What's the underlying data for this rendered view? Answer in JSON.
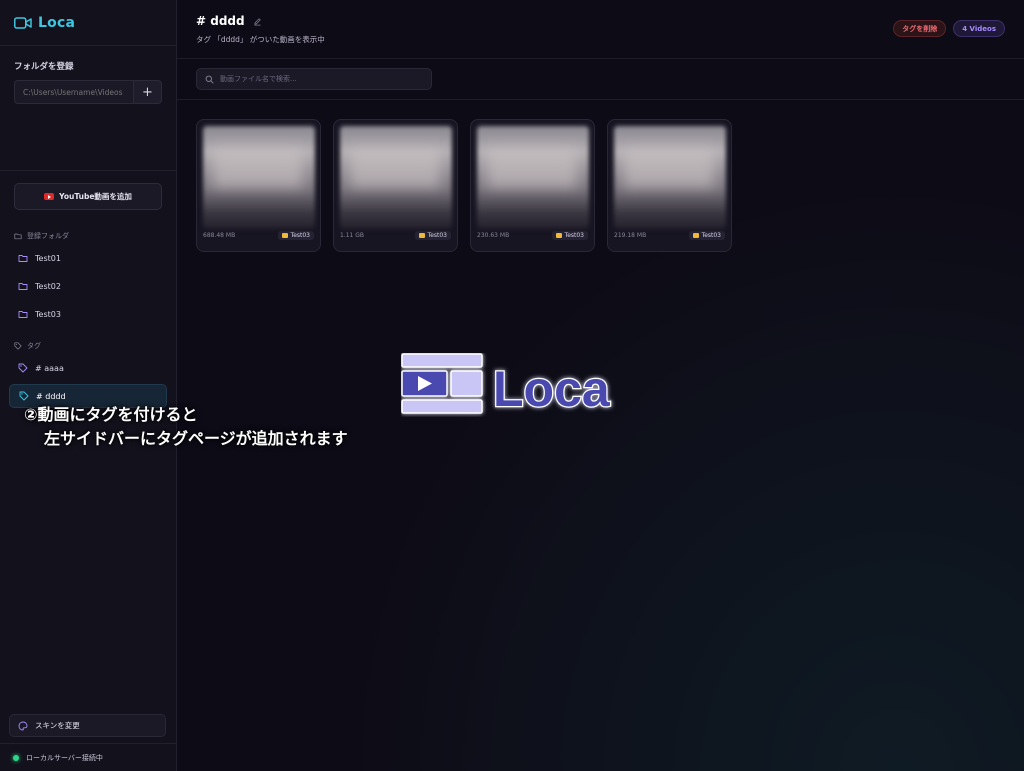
{
  "app": {
    "name": "Loca"
  },
  "sidebar": {
    "folder_section_title": "フォルダを登録",
    "folder_path_placeholder": "C:\\Users\\Username\\Videos",
    "add_button": "+",
    "youtube_button": "YouTube動画を追加",
    "folders_header": "登録フォルダ",
    "folders": [
      "Test01",
      "Test02",
      "Test03"
    ],
    "tags_header": "タグ",
    "tags": [
      "# aaaa",
      "# dddd"
    ],
    "active_tag": "# dddd",
    "skin_button": "スキンを変更",
    "status": "ローカルサーバー接続中"
  },
  "header": {
    "title": "# dddd",
    "subtitle": "タグ 「dddd」 がついた動画を表示中",
    "delete_tag": "タグを削除",
    "video_count": "4 Videos"
  },
  "search": {
    "placeholder": "動画ファイル名で検索..."
  },
  "videos": [
    {
      "size": "688.48 MB",
      "folder": "Test03"
    },
    {
      "size": "1.11 GB",
      "folder": "Test03"
    },
    {
      "size": "230.63 MB",
      "folder": "Test03"
    },
    {
      "size": "219.18 MB",
      "folder": "Test03"
    }
  ],
  "overlay": {
    "logo_text": "Loca",
    "caption_line1": "②動画にタグを付けると",
    "caption_line2": "左サイドバーにタグページが追加されます"
  },
  "colors": {
    "accent": "#3ec6e0",
    "danger": "#ef6b73",
    "purple": "#a68bff",
    "status": "#2fd58a"
  }
}
